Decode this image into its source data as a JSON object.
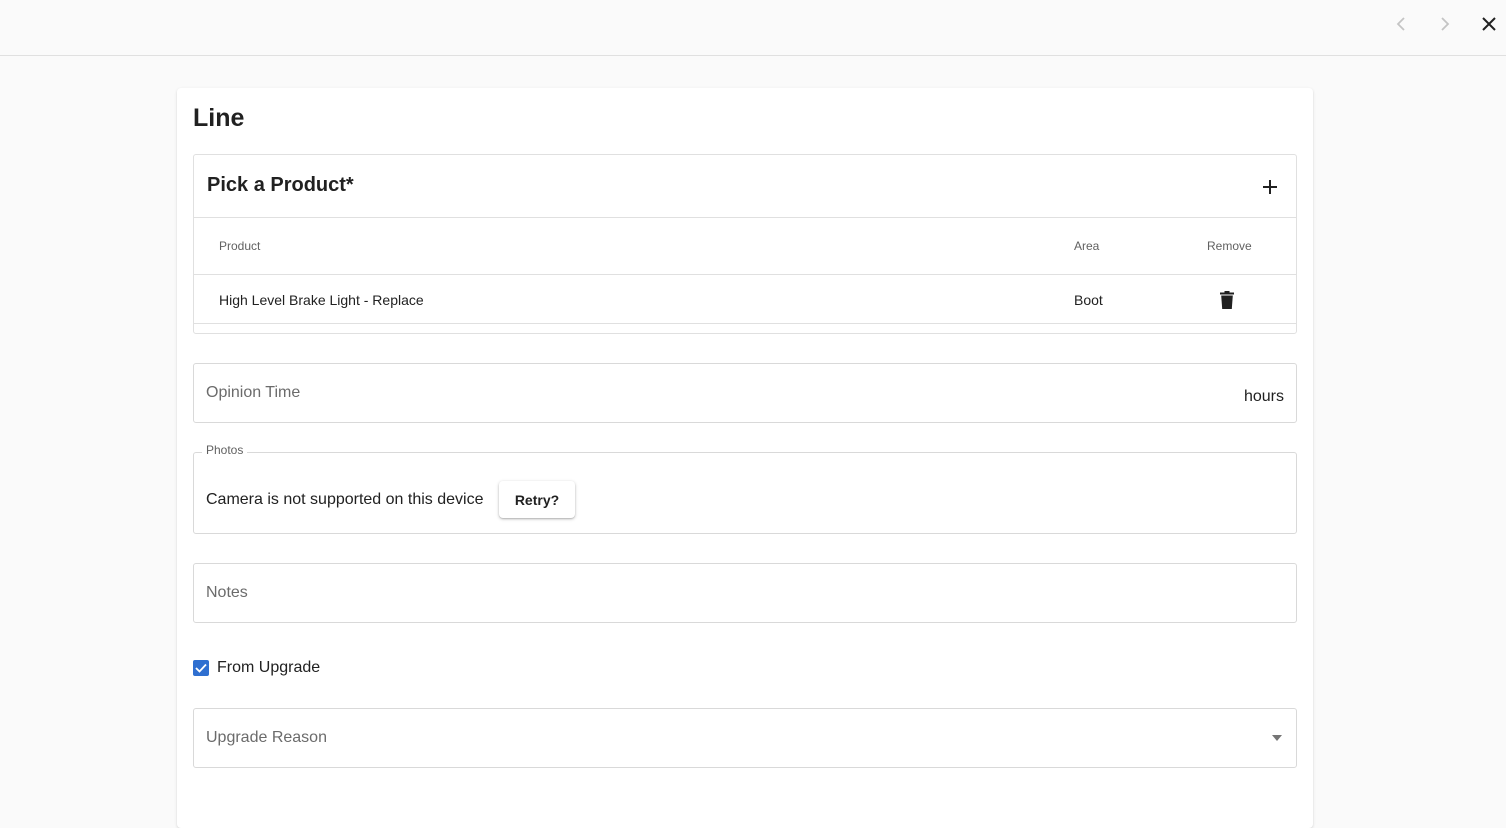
{
  "card": {
    "title": "Line"
  },
  "product_panel": {
    "title": "Pick a Product*",
    "columns": {
      "product": "Product",
      "area": "Area",
      "remove": "Remove"
    },
    "rows": [
      {
        "product": "High Level Brake Light - Replace",
        "area": "Boot"
      }
    ]
  },
  "opinion_time": {
    "placeholder": "Opinion Time",
    "suffix": "hours"
  },
  "photos": {
    "legend": "Photos",
    "message": "Camera is not supported on this device",
    "retry_label": "Retry?"
  },
  "notes": {
    "placeholder": "Notes"
  },
  "from_upgrade": {
    "label": "From Upgrade",
    "checked": true
  },
  "upgrade_reason": {
    "placeholder": "Upgrade Reason"
  },
  "colors": {
    "accent": "#2f6fd0"
  },
  "icons": {
    "prev": "chevron-left-icon",
    "next": "chevron-right-icon",
    "close": "close-icon",
    "add": "plus-icon",
    "remove": "trash-icon",
    "check": "check-icon",
    "dropdown": "caret-down-icon"
  }
}
